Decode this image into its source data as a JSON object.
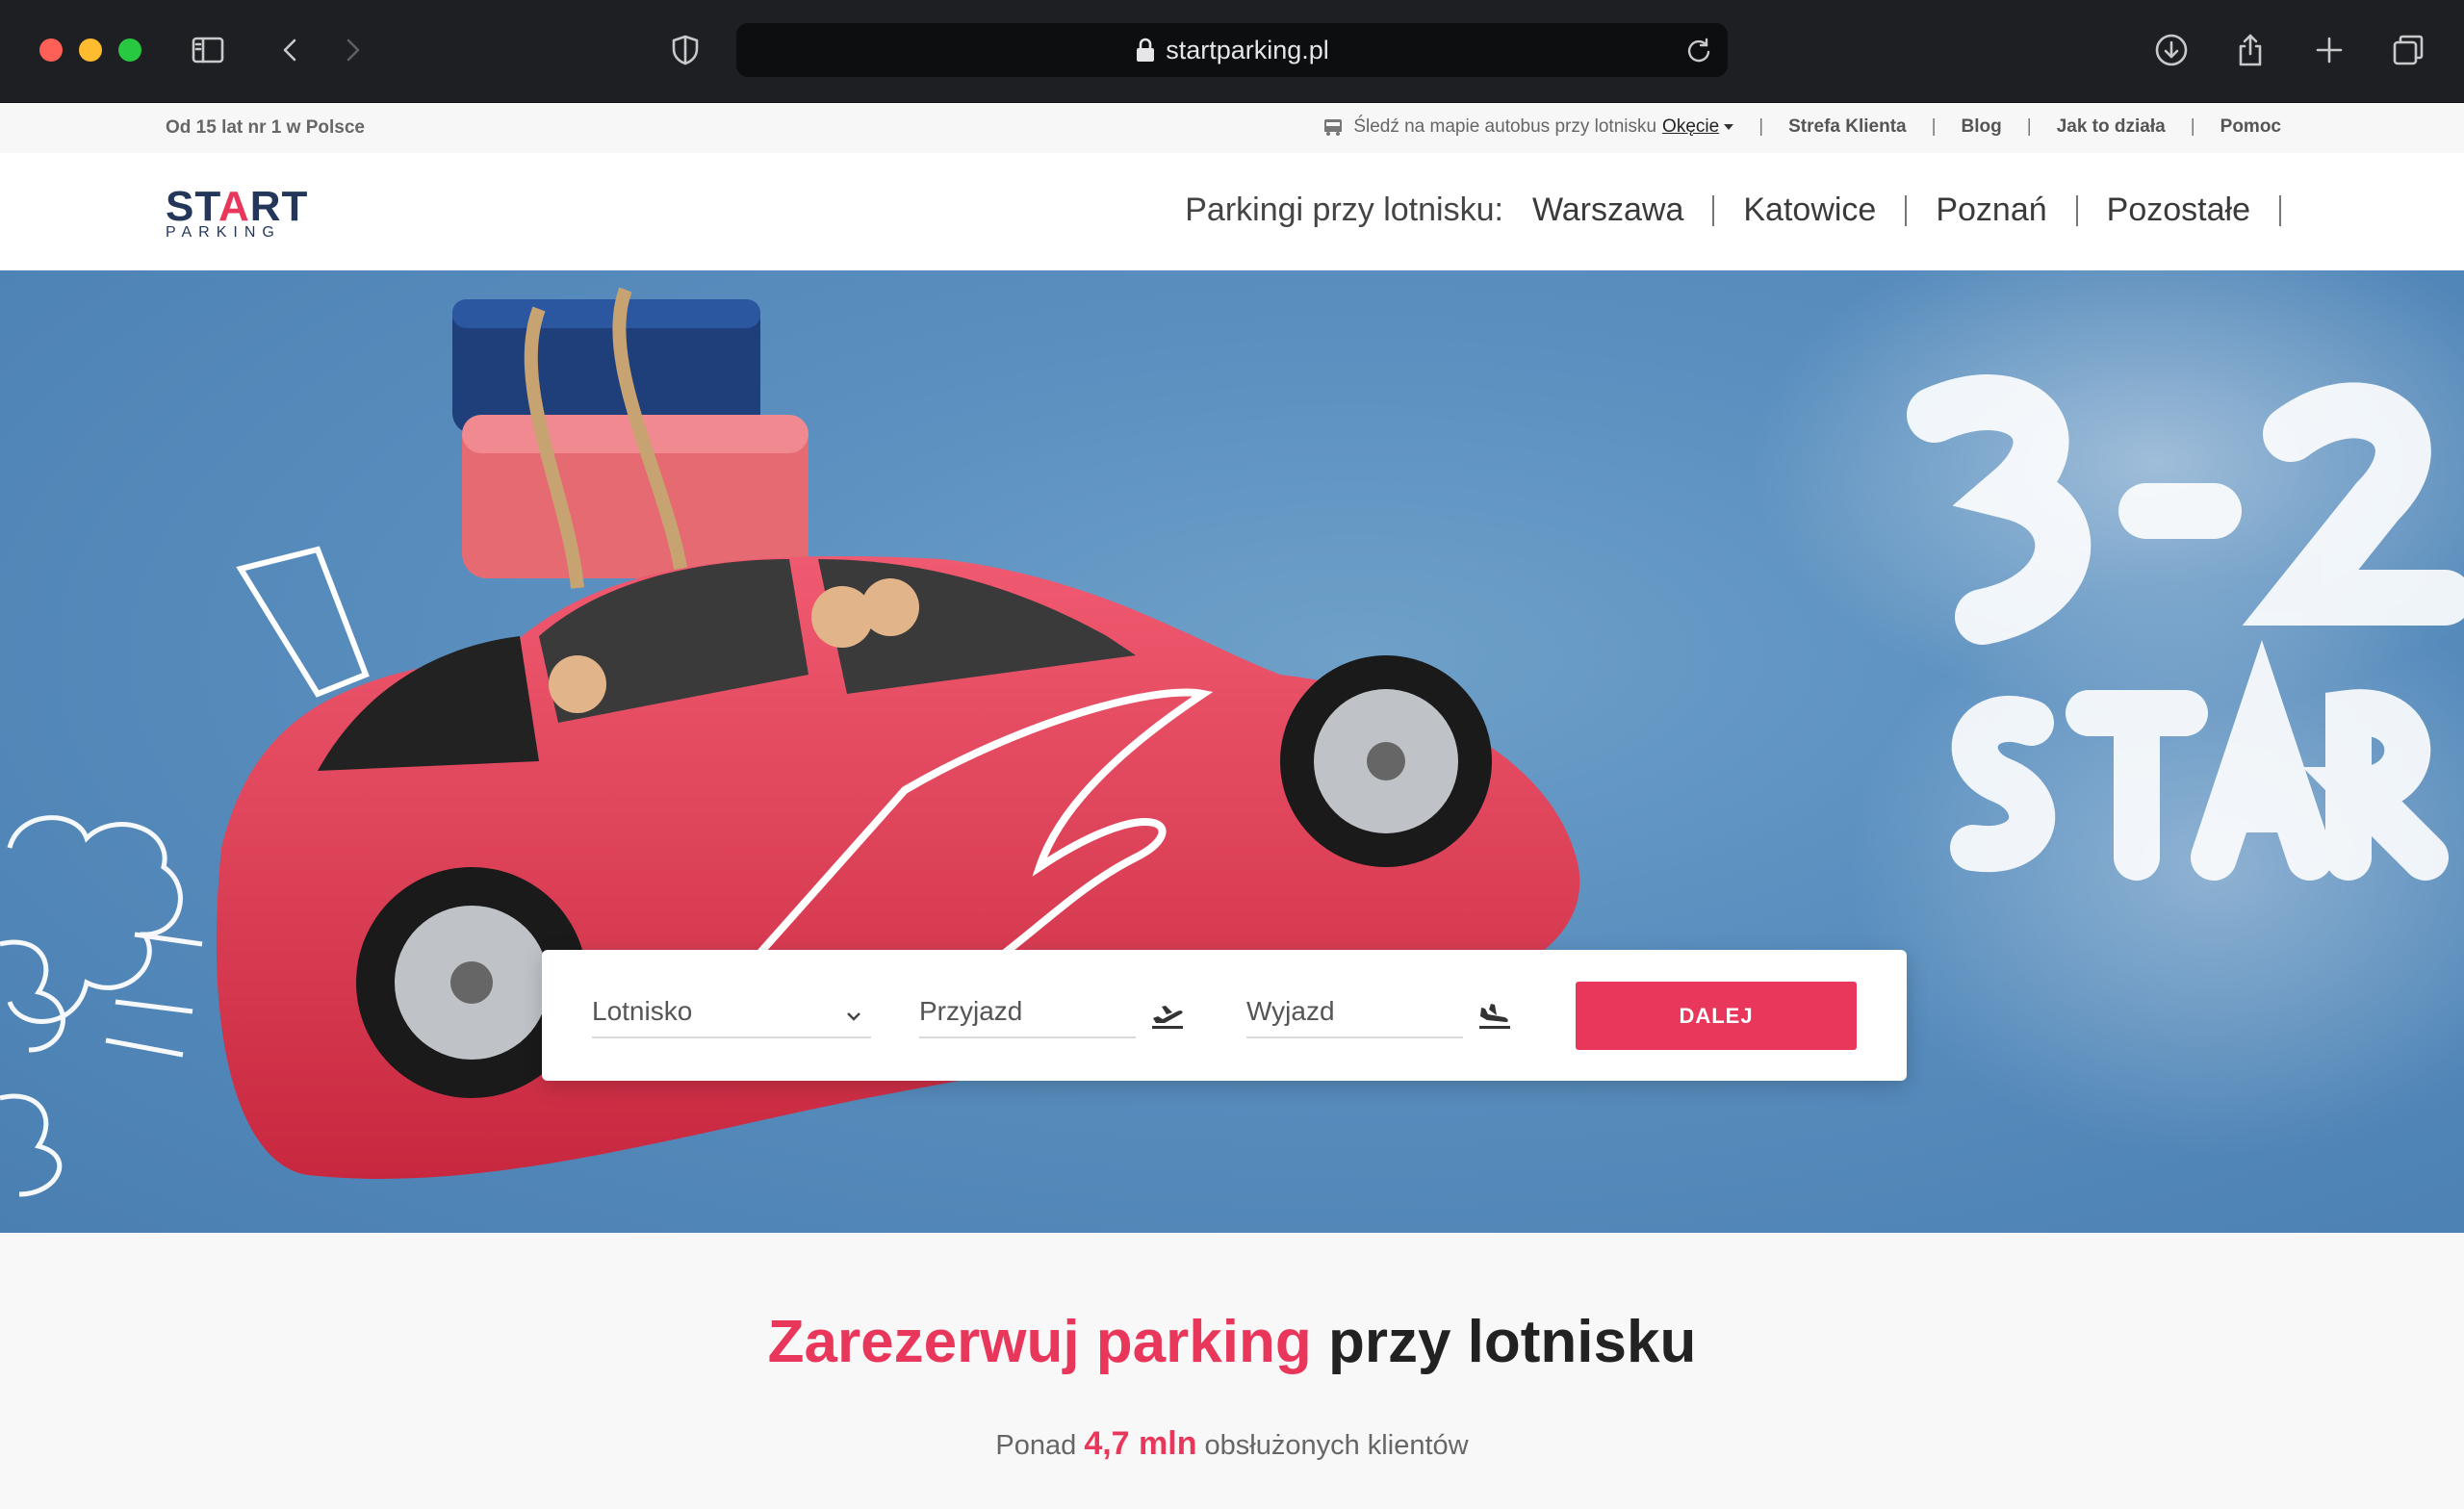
{
  "browser": {
    "url": "startparking.pl",
    "icons": [
      "sidebar-icon",
      "back-icon",
      "forward-icon",
      "shield-icon",
      "lock-icon",
      "reload-icon",
      "download-icon",
      "share-icon",
      "new-tab-icon",
      "tabs-overview-icon"
    ]
  },
  "utility_bar": {
    "tagline": "Od 15 lat nr 1 w Polsce",
    "bus_text": "Śledź na mapie autobus przy lotnisku",
    "bus_link": "Okęcie",
    "links": [
      "Strefa Klienta",
      "Blog",
      "Jak to działa",
      "Pomoc"
    ]
  },
  "header": {
    "logo_main_prefix": "ST",
    "logo_main_accent": "A",
    "logo_main_suffix": "RT",
    "logo_sub": "PARKING",
    "nav_title": "Parkingi przy lotnisku:",
    "nav_links": [
      "Warszawa",
      "Katowice",
      "Poznań",
      "Pozostałe"
    ]
  },
  "search": {
    "airport_label": "Lotnisko",
    "arrival_label": "Przyjazd",
    "departure_label": "Wyjazd",
    "submit_label": "DALEJ"
  },
  "section": {
    "title_accent": "Zarezerwuj parking",
    "title_rest": " przy lotnisku",
    "sub_prefix": "Ponad ",
    "sub_accent": "4,7 mln",
    "sub_suffix": " obsłużonych klientów"
  },
  "colors": {
    "brand_red": "#e8375a",
    "brand_navy": "#24375b",
    "sky": "#5a8fbf"
  }
}
